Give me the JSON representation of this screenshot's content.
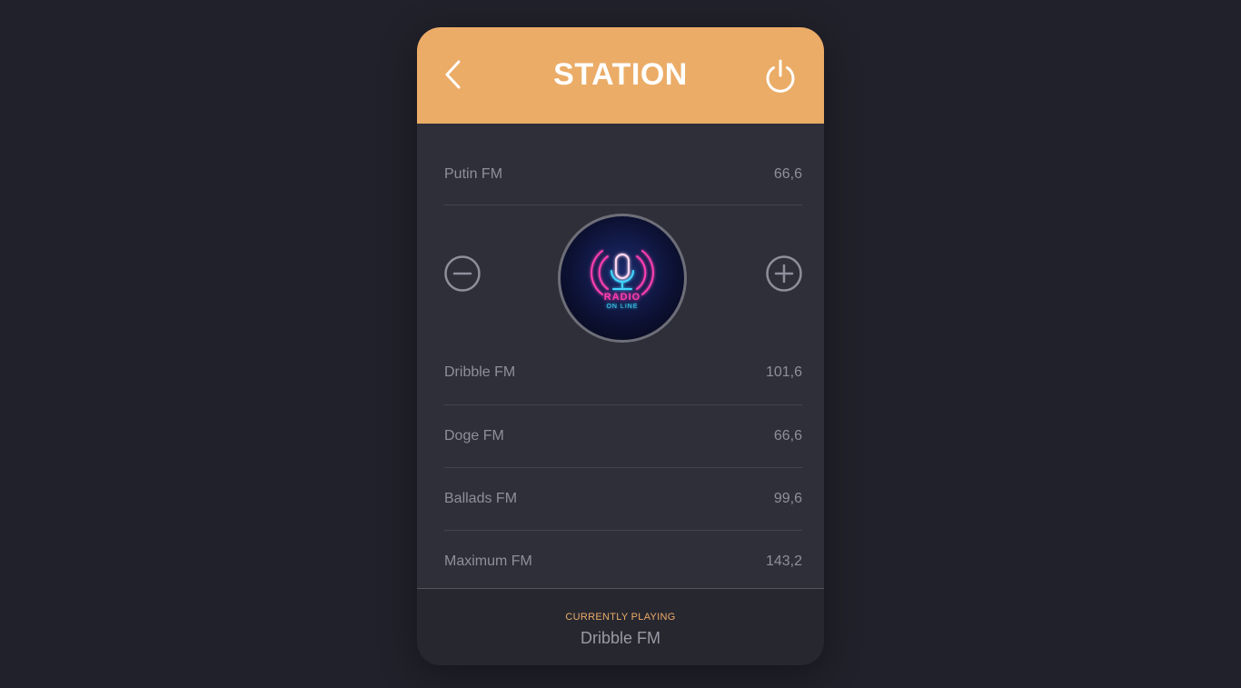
{
  "header": {
    "title": "STATION",
    "back_icon": "chevron-left-icon",
    "power_icon": "power-icon"
  },
  "stations": [
    {
      "name": "Putin FM",
      "freq": "66,6"
    },
    {
      "name": "Dribble FM",
      "freq": "101,6"
    },
    {
      "name": "Doge FM",
      "freq": "66,6"
    },
    {
      "name": "Ballads FM",
      "freq": "99,6"
    },
    {
      "name": "Maximum FM",
      "freq": "143,2"
    }
  ],
  "player": {
    "minus_icon": "minus-circle-icon",
    "plus_icon": "plus-circle-icon",
    "logo_text_top": "RADIO",
    "logo_text_bottom": "ON LINE"
  },
  "footer": {
    "label": "CURRENTLY PLAYING",
    "station": "Dribble FM"
  },
  "colors": {
    "accent": "#ebac67",
    "background": "#21212b",
    "card": "#2f2f3a",
    "neon_pink": "#ff3fb0",
    "neon_cyan": "#3fd6ff"
  }
}
